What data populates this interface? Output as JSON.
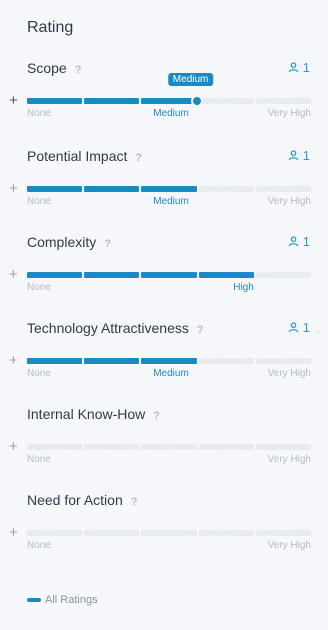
{
  "panel": {
    "title": "Rating"
  },
  "ratings": [
    {
      "label": "Scope",
      "help": "?",
      "count": "1",
      "level": 3,
      "level_label": "Medium",
      "tooltip": "Medium",
      "scale_min": "None",
      "scale_max": "Very High"
    },
    {
      "label": "Potential Impact",
      "help": "?",
      "count": "1",
      "level": 3,
      "level_label": "Medium",
      "scale_min": "None",
      "scale_max": "Very High"
    },
    {
      "label": "Complexity",
      "help": "?",
      "count": "1",
      "level": 4,
      "level_label": "High",
      "scale_min": "None",
      "scale_max": ""
    },
    {
      "label": "Technology Attractiveness",
      "help": "?",
      "count": "1",
      "level": 3,
      "level_label": "Medium",
      "scale_min": "None",
      "scale_max": "Very High"
    },
    {
      "label": "Internal Know-How",
      "help": "?",
      "count": "",
      "level": 0,
      "level_label": "",
      "scale_min": "None",
      "scale_max": "Very High"
    },
    {
      "label": "Need for Action",
      "help": "?",
      "count": "",
      "level": 0,
      "level_label": "",
      "scale_min": "None",
      "scale_max": "Very High"
    }
  ],
  "scale": {
    "segments": 5
  },
  "legend": {
    "label": "All Ratings"
  },
  "colors": {
    "accent": "#1a8ac4",
    "count": "#2a9ad1"
  },
  "icons": {
    "count": "user-icon",
    "add": "plus-icon",
    "help": "help-icon"
  }
}
